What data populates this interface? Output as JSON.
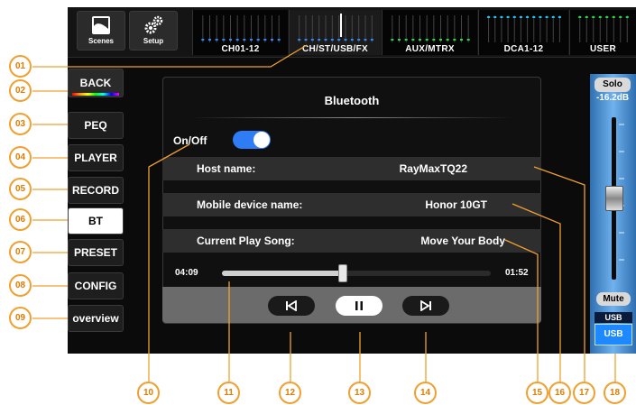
{
  "topbar": {
    "scenes_label": "Scenes",
    "setup_label": "Setup",
    "banks": [
      "CH01-12",
      "CH/ST/USB/FX",
      "AUX/MTRX",
      "DCA1-12",
      "USER"
    ]
  },
  "left_menu": [
    "BACK",
    "PEQ",
    "PLAYER",
    "RECORD",
    "BT",
    "PRESET",
    "CONFIG",
    "overview"
  ],
  "dialog": {
    "title": "Bluetooth",
    "onoff_label": "On/Off",
    "rows": [
      {
        "key": "Host name:",
        "value": "RayMaxTQ22"
      },
      {
        "key": "Mobile device name:",
        "value": "Honor 10GT"
      },
      {
        "key": "Current Play Song:",
        "value": "Move Your Body"
      }
    ],
    "time_elapsed": "04:09",
    "time_remaining": "01:52",
    "progress": 0.45,
    "prev_symbol": "⏮",
    "pause_symbol": "⏸",
    "next_symbol": "⏭"
  },
  "strip": {
    "solo_label": "Solo",
    "level": "-16.2dB",
    "mute_label": "Mute",
    "source_label": "USB",
    "channel_label": "USB"
  },
  "callouts": {
    "c01": "01",
    "c02": "02",
    "c03": "03",
    "c04": "04",
    "c05": "05",
    "c06": "06",
    "c07": "07",
    "c08": "08",
    "c09": "09",
    "c10": "10",
    "c11": "11",
    "c12": "12",
    "c13": "13",
    "c14": "14",
    "c15": "15",
    "c16": "16",
    "c17": "17",
    "c18": "18"
  },
  "colors": {
    "accent_blue": "#2f7df6",
    "callout_orange": "#f0a030",
    "meter_blue": "#2a8cff",
    "meter_green": "#22dd44",
    "meter_cyan": "#18c8ff"
  }
}
